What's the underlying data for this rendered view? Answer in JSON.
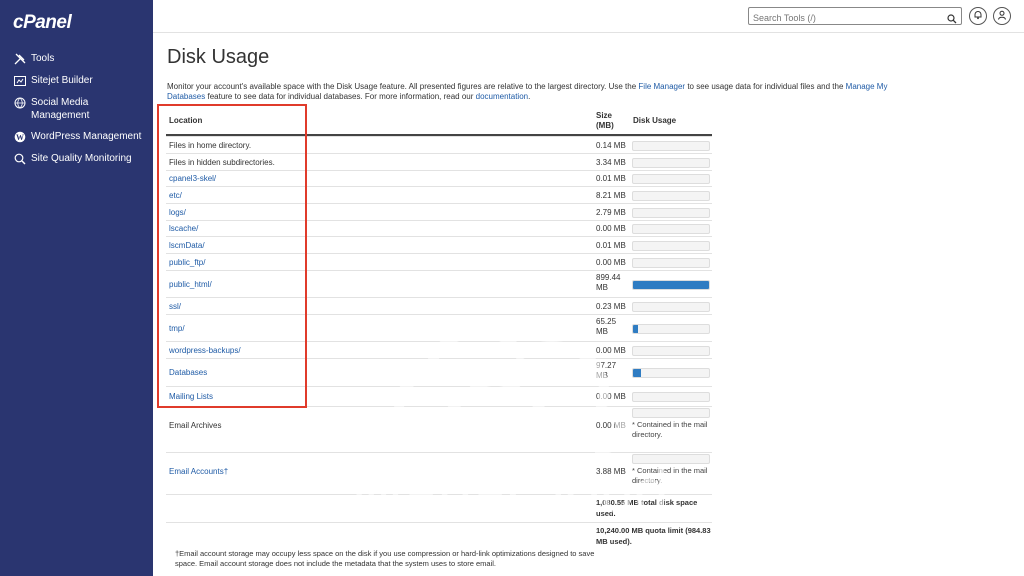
{
  "brand": {
    "logo": "cPanel"
  },
  "sidebar": {
    "items": [
      {
        "label": "Tools",
        "icon": "tools-icon"
      },
      {
        "label": "Sitejet Builder",
        "icon": "sitejet-icon"
      },
      {
        "label": "Social Media Management",
        "icon": "social-icon"
      },
      {
        "label": "WordPress Management",
        "icon": "wordpress-icon"
      },
      {
        "label": "Site Quality Monitoring",
        "icon": "monitor-icon"
      }
    ]
  },
  "topbar": {
    "search_placeholder": "Search Tools (/)"
  },
  "page": {
    "title": "Disk Usage",
    "intro_1": "Monitor your account's available space with the Disk Usage feature. All presented figures are relative to the largest directory. Use the ",
    "intro_link_1": "File Manager",
    "intro_2": " to see usage data for individual files and the ",
    "intro_link_2": "Manage My Databases",
    "intro_3": " feature to see data for individual databases. For more information, read our ",
    "intro_link_3": "documentation",
    "intro_4": "."
  },
  "table": {
    "headers": {
      "location": "Location",
      "size": "Size (MB)",
      "usage": "Disk Usage"
    },
    "rows": [
      {
        "location": "Files in home directory.",
        "size": "0.14 MB",
        "link": false,
        "fill": 0.0
      },
      {
        "location": "Files in hidden subdirectories.",
        "size": "3.34 MB",
        "link": false,
        "fill": 0.0
      },
      {
        "location": "cpanel3-skel/",
        "size": "0.01 MB",
        "link": true,
        "fill": 0.0
      },
      {
        "location": "etc/",
        "size": "8.21 MB",
        "link": true,
        "fill": 0.0
      },
      {
        "location": "logs/",
        "size": "2.79 MB",
        "link": true,
        "fill": 0.0
      },
      {
        "location": "lscache/",
        "size": "0.00 MB",
        "link": true,
        "fill": 0.0
      },
      {
        "location": "lscmData/",
        "size": "0.01 MB",
        "link": true,
        "fill": 0.0
      },
      {
        "location": "public_ftp/",
        "size": "0.00 MB",
        "link": true,
        "fill": 0.0
      },
      {
        "location": "public_html/",
        "size": "899.44 MB",
        "link": true,
        "fill": 1.0
      },
      {
        "location": "ssl/",
        "size": "0.23 MB",
        "link": true,
        "fill": 0.0
      },
      {
        "location": "tmp/",
        "size": "65.25 MB",
        "link": true,
        "fill": 0.07
      },
      {
        "location": "wordpress-backups/",
        "size": "0.00 MB",
        "link": true,
        "fill": 0.0
      },
      {
        "location": "Databases",
        "size": "97.27 MB",
        "link": true,
        "fill": 0.11
      },
      {
        "location": "Mailing Lists",
        "size": "0.00 MB",
        "link": true,
        "fill": 0.0
      }
    ],
    "email_archives": {
      "location": "Email Archives",
      "size": "0.00 MB",
      "note": "* Contained in the mail directory."
    },
    "email_accounts": {
      "location": "Email Accounts†",
      "size": "3.88 MB",
      "note": "* Contained in the mail directory."
    },
    "total": "1,080.55 MB total disk space used.",
    "quota": "10,240.00 MB quota limit (984.83 MB used)."
  },
  "footnote": "†Email account storage may occupy less space on the disk if you use compression or hard-link optimizations designed to save space. Email account storage does not include the metadata that the system uses to store email.",
  "watermark": {
    "text": "ManaCloud"
  },
  "colors": {
    "sidebar": "#2a3570",
    "link": "#1f5ba6",
    "bar_fill": "#2f7cc2",
    "highlight": "#e03b2b"
  }
}
